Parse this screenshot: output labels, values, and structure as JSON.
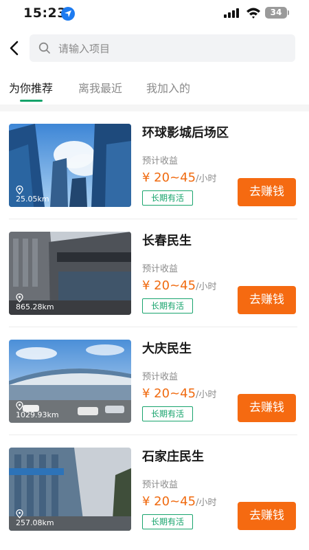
{
  "status_bar": {
    "time": "15:23",
    "battery": "34"
  },
  "search": {
    "placeholder": "请输入项目"
  },
  "tabs": [
    {
      "label": "为你推荐",
      "active": true
    },
    {
      "label": "离我最近",
      "active": false
    },
    {
      "label": "我加入的",
      "active": false
    }
  ],
  "colors": {
    "accent_green": "#15a36b",
    "price_orange": "#f06a0f",
    "button_orange": "#f56a11"
  },
  "projects": [
    {
      "name": "环球影城后场区",
      "distance": "25.05km",
      "earn_label": "预计收益",
      "price": "¥ 20~45",
      "unit": "/小时",
      "tag": "长期有活",
      "button": "去赚钱"
    },
    {
      "name": "长春民生",
      "distance": "865.28km",
      "earn_label": "预计收益",
      "price": "¥ 20~45",
      "unit": "/小时",
      "tag": "长期有活",
      "button": "去赚钱"
    },
    {
      "name": "大庆民生",
      "distance": "1029.93km",
      "earn_label": "预计收益",
      "price": "¥ 20~45",
      "unit": "/小时",
      "tag": "长期有活",
      "button": "去赚钱"
    },
    {
      "name": "石家庄民生",
      "distance": "257.08km",
      "earn_label": "预计收益",
      "price": "¥ 20~45",
      "unit": "/小时",
      "tag": "长期有活",
      "button": "去赚钱"
    }
  ]
}
